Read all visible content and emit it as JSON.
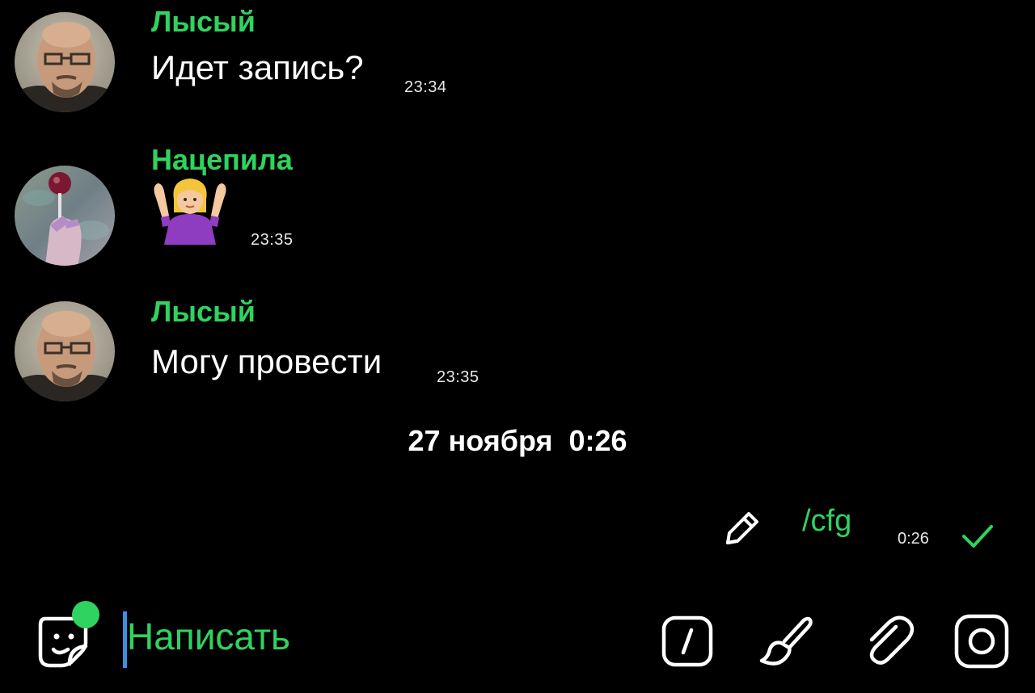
{
  "colors": {
    "background": "#000000",
    "accent": "#2fd35f",
    "text": "#ffffff",
    "caret": "#3d8fe0"
  },
  "messages": [
    {
      "author": "Лысый",
      "text": "Идет запись?",
      "time": "23:34",
      "avatar": "bald-man-glasses-avatar"
    },
    {
      "author": "Нацепила",
      "emoji": "person-shrugging-emoji",
      "time": "23:35",
      "avatar": "lollipop-hand-avatar"
    },
    {
      "author": "Лысый",
      "text": "Могу провести",
      "time": "23:35",
      "avatar": "bald-man-glasses-avatar"
    }
  ],
  "date_separator": "27 ноября  0:26",
  "own_message": {
    "text": "/cfg",
    "time": "0:26",
    "status_icon": "check-icon",
    "edit_icon": "pencil-icon"
  },
  "composer": {
    "placeholder": "Написать",
    "sticker_icon": "sticker-icon",
    "icons": [
      "command-icon",
      "brush-icon",
      "paperclip-icon",
      "camera-icon"
    ]
  }
}
